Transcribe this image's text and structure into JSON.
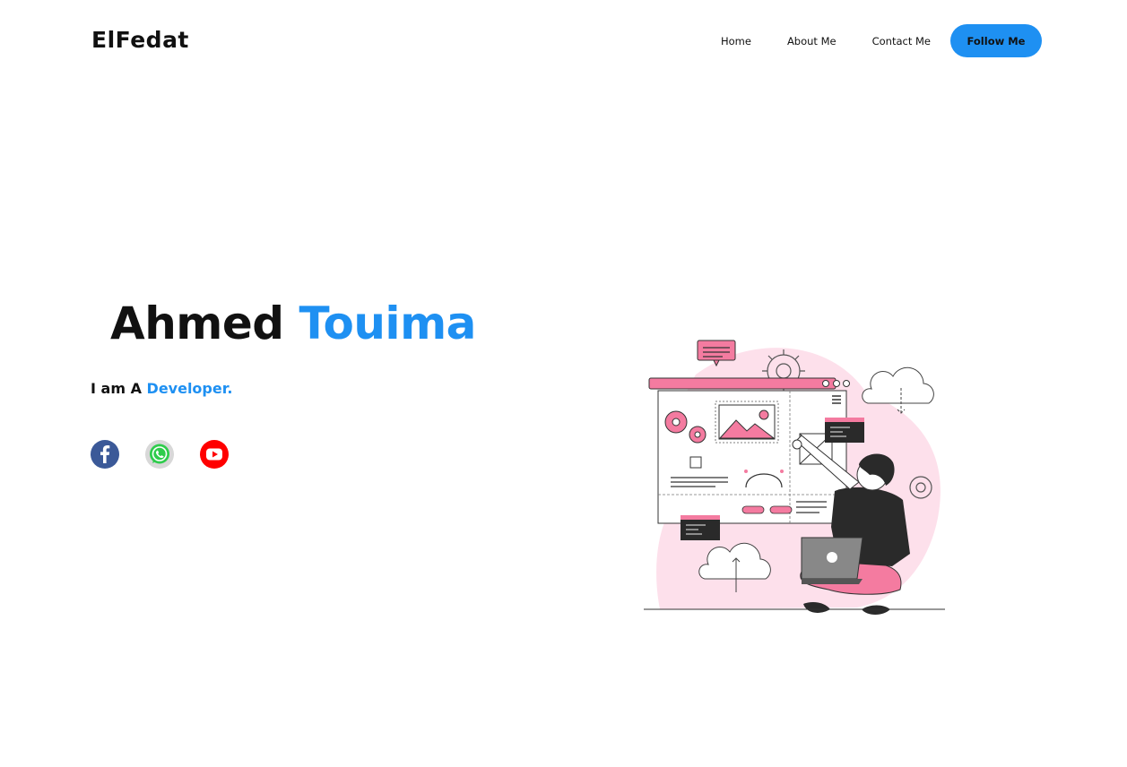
{
  "header": {
    "logo": "ElFedat",
    "nav": [
      {
        "label": "Home"
      },
      {
        "label": "About Me"
      },
      {
        "label": "Contact Me"
      }
    ],
    "cta_label": "Follow Me"
  },
  "hero": {
    "first_name": "Ahmed",
    "last_name": "Touima",
    "tagline_prefix": "I am A",
    "tagline_role": "Developer."
  },
  "social": [
    {
      "icon": "facebook-icon"
    },
    {
      "icon": "whatsapp-icon"
    },
    {
      "icon": "youtube-icon"
    }
  ],
  "colors": {
    "accent": "#1e90f2",
    "illustration_pink": "#f47ba0",
    "illustration_blob": "#fde0eb",
    "text": "#111111"
  }
}
